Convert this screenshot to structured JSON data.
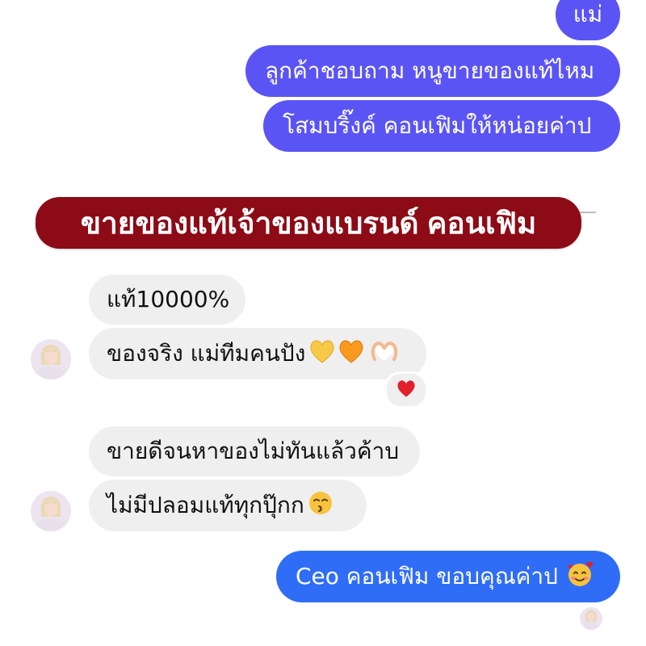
{
  "colors": {
    "outgoing_purple": "#5b54f5",
    "outgoing_blue": "#2f6df7",
    "incoming_bg": "#efefef",
    "banner_bg": "#8c0b16"
  },
  "messages": {
    "out_1": "แม่",
    "out_2": "ลูกค้าชอบถาม หนูขายของแท้ไหม",
    "out_3": "โสมบริ๊งค์ คอนเฟิมให้หน่อยค่าป",
    "in_1": "แท้10000%",
    "in_2": "ของจริง แม่ทีมคนปัง",
    "in_3": "ขายดีจนหาของไม่ทันแล้วค้าบ",
    "in_4": "ไม่มีปลอมแท้ทุกปุ๊กก",
    "out_4": "Ceo คอนเฟิม ขอบคุณค่าป"
  },
  "banner": {
    "text": "ขายของแท้เจ้าของแบรนด์ คอนเฟิม"
  },
  "icons": {
    "in_2_emojis": [
      "yellow-heart-icon",
      "orange-heart-icon",
      "heart-hands-icon"
    ],
    "in_2_reaction": "red-heart-icon",
    "in_4_emoji": "kissing-face-icon",
    "out_4_emoji": "smiling-face-with-hearts-icon"
  }
}
